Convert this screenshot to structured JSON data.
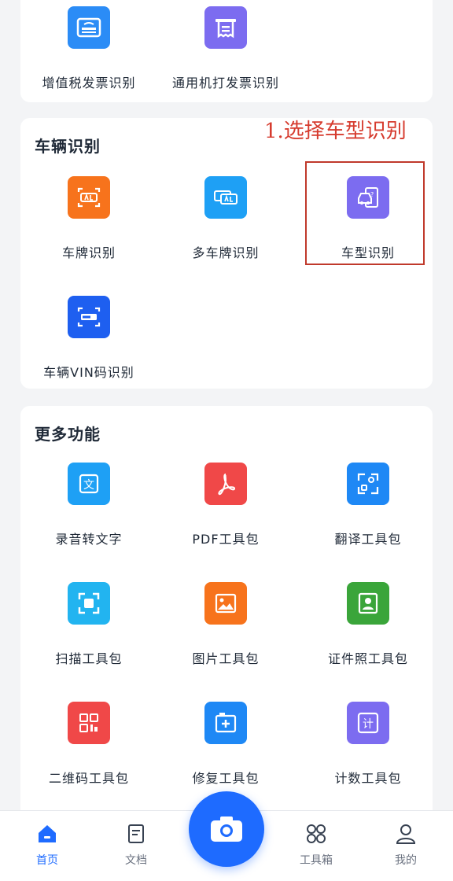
{
  "top_section": {
    "items": [
      {
        "label": "增值税发票识别",
        "icon": "vat-invoice-icon",
        "color": "#2b8cf6"
      },
      {
        "label": "通用机打发票识别",
        "icon": "printed-invoice-icon",
        "color": "#7c6cf0"
      }
    ]
  },
  "vehicle_section": {
    "title": "车辆识别",
    "items": [
      {
        "label": "车牌识别",
        "icon": "license-plate-icon",
        "color": "#f7731c"
      },
      {
        "label": "多车牌识别",
        "icon": "multi-plate-icon",
        "color": "#1ea0f5"
      },
      {
        "label": "车型识别",
        "icon": "car-model-icon",
        "color": "#7c6cf0"
      },
      {
        "label": "车辆VIN码识别",
        "icon": "vin-code-icon",
        "color": "#1e5ff0"
      }
    ]
  },
  "annotation": {
    "text": "1.选择车型识别",
    "color": "#d63b2e"
  },
  "more_section": {
    "title": "更多功能",
    "items": [
      {
        "label": "录音转文字",
        "icon": "speech-to-text-icon",
        "color": "#1ea0f5"
      },
      {
        "label": "PDF工具包",
        "icon": "pdf-icon",
        "color": "#f04848"
      },
      {
        "label": "翻译工具包",
        "icon": "translate-icon",
        "color": "#1e88f5"
      },
      {
        "label": "扫描工具包",
        "icon": "scan-icon",
        "color": "#22b4f0"
      },
      {
        "label": "图片工具包",
        "icon": "image-icon",
        "color": "#f7731c"
      },
      {
        "label": "证件照工具包",
        "icon": "id-photo-icon",
        "color": "#3aa53a"
      },
      {
        "label": "二维码工具包",
        "icon": "qr-code-icon",
        "color": "#f04848"
      },
      {
        "label": "修复工具包",
        "icon": "repair-icon",
        "color": "#1e88f5"
      },
      {
        "label": "计数工具包",
        "icon": "counter-icon",
        "color": "#7c6cf0"
      }
    ]
  },
  "tabbar": {
    "items": [
      {
        "label": "首页",
        "icon": "home-icon",
        "active": true
      },
      {
        "label": "文档",
        "icon": "document-icon",
        "active": false
      },
      {
        "label": "工具箱",
        "icon": "toolbox-icon",
        "active": false
      },
      {
        "label": "我的",
        "icon": "profile-icon",
        "active": false
      }
    ],
    "camera_icon": "camera-icon",
    "accent": "#1e6bff"
  }
}
